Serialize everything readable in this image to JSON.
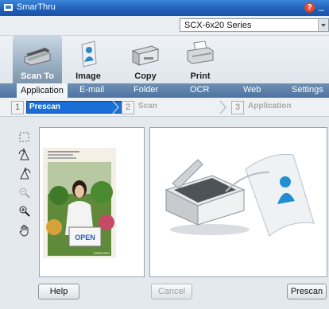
{
  "window": {
    "title": "SmarThru"
  },
  "device": {
    "selected": "SCX-6x20 Series"
  },
  "toolbar": {
    "tools": [
      {
        "label": "Scan To",
        "icon": "scanner-icon",
        "active": true
      },
      {
        "label": "Image",
        "icon": "person-document-icon",
        "active": false
      },
      {
        "label": "Copy",
        "icon": "copier-icon",
        "active": false
      },
      {
        "label": "Print",
        "icon": "printer-icon",
        "active": false
      }
    ]
  },
  "menu": {
    "items": [
      "Application",
      "E-mail",
      "Folder",
      "OCR",
      "Web",
      "Settings"
    ],
    "selected": "Application"
  },
  "steps": [
    {
      "num": "1",
      "label": "Prescan",
      "active": true
    },
    {
      "num": "2",
      "label": "Scan",
      "active": false
    },
    {
      "num": "3",
      "label": "Application",
      "active": false
    }
  ],
  "preview": {
    "sign_text": "OPEN",
    "brand_text": "SAMSUNG"
  },
  "buttons": {
    "help": "Help",
    "cancel": "Cancel",
    "prescan": "Prescan"
  },
  "colors": {
    "titlebar": "#1f5fb8",
    "menubar": "#5a7eaa",
    "step_active": "#1a6fd6"
  }
}
